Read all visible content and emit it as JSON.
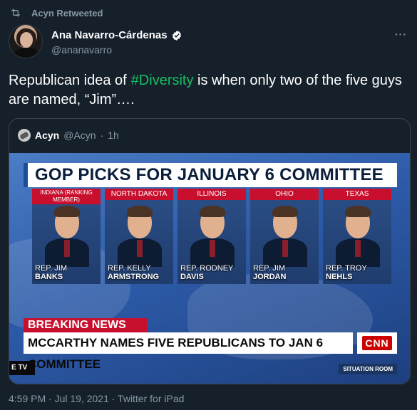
{
  "retweet": {
    "icon": "retweet-icon",
    "label": "Acyn Retweeted"
  },
  "author": {
    "name": "Ana Navarro-Cárdenas",
    "handle": "@ananavarro",
    "verified_icon": "verified-badge-icon"
  },
  "more_label": "···",
  "tweet": {
    "text_before": "Republican idea of",
    "hashtag": "#Diversity",
    "text_after": "is when only two of the five guys are named, “Jim”…."
  },
  "quote": {
    "name": "Acyn",
    "handle": "@Acyn",
    "separator": "·",
    "time": "1h",
    "media": {
      "title": "GOP PICKS FOR JANUARY 6 COMMITTEE",
      "panels": [
        {
          "state": "INDIANA (RANKING MEMBER)",
          "rep": "REP. JIM",
          "surname": "BANKS"
        },
        {
          "state": "NORTH DAKOTA",
          "rep": "REP. KELLY",
          "surname": "ARMSTRONG"
        },
        {
          "state": "ILLINOIS",
          "rep": "REP. RODNEY",
          "surname": "DAVIS"
        },
        {
          "state": "OHIO",
          "rep": "REP. JIM",
          "surname": "JORDAN"
        },
        {
          "state": "TEXAS",
          "rep": "REP. TROY",
          "surname": "NEHLS"
        }
      ],
      "breaking": "BREAKING NEWS",
      "headline": "MCCARTHY NAMES FIVE REPUBLICANS TO JAN 6 COMMITTEE",
      "logo": "CNN",
      "live_tv": "E TV",
      "situation": "SITUATION ROOM"
    }
  },
  "footer": {
    "meta": "4:59 PM · Jul 19, 2021 · Twitter for iPad"
  },
  "colors": {
    "background": "#15202b",
    "secondary_text": "#8899a6",
    "hashtag": "#17bf63",
    "breaking_red": "#c8102e"
  }
}
